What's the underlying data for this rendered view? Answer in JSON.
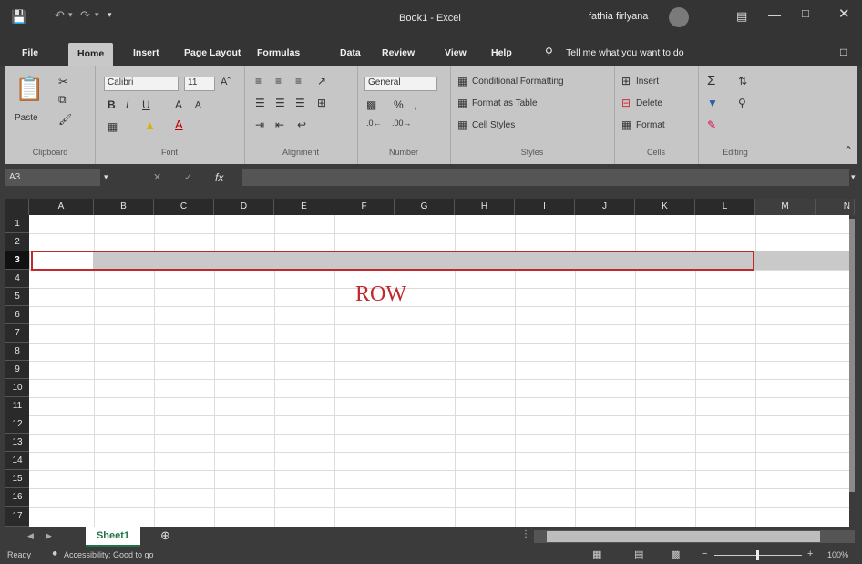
{
  "window": {
    "title": "Book1  -  Excel",
    "user": "fathia firlyana",
    "accent": "#217346",
    "title_bar_color": "#343434"
  },
  "menu": {
    "items": [
      "File",
      "Home",
      "Insert",
      "Page Layout",
      "Formulas",
      "Data",
      "Review",
      "View",
      "Help"
    ],
    "tell_me": "Tell me what you want to do",
    "active": "Home"
  },
  "ribbon": {
    "clipboard": {
      "label": "Clipboard",
      "paste": "Paste"
    },
    "font": {
      "label": "Font",
      "name": "Calibri",
      "size": "11"
    },
    "alignment": {
      "label": "Alignment"
    },
    "number": {
      "label": "Number",
      "format": "General"
    },
    "styles": {
      "label": "Styles",
      "conditional": "Conditional Formatting",
      "table": "Format as Table",
      "cell": "Cell Styles"
    },
    "cells": {
      "label": "Cells",
      "insert": "Insert",
      "delete": "Delete",
      "format": "Format"
    },
    "editing": {
      "label": "Editing"
    }
  },
  "formula_bar": {
    "name_box": "A3",
    "fx": "fx",
    "value": ""
  },
  "grid": {
    "columns": [
      "A",
      "B",
      "C",
      "D",
      "E",
      "F",
      "G",
      "H",
      "I",
      "J",
      "K",
      "L",
      "M",
      "N"
    ],
    "rows": [
      "1",
      "2",
      "3",
      "4",
      "5",
      "6",
      "7",
      "8",
      "9",
      "10",
      "11",
      "12",
      "13",
      "14",
      "15",
      "16",
      "17"
    ],
    "selected_row": "3",
    "annotation": "ROW",
    "annotation_color": "#c0282d"
  },
  "sheets": {
    "tabs": [
      "Sheet1"
    ],
    "active": "Sheet1"
  },
  "status": {
    "ready": "Ready",
    "accessibility": "Accessibility: Good to go",
    "zoom": "100%"
  }
}
